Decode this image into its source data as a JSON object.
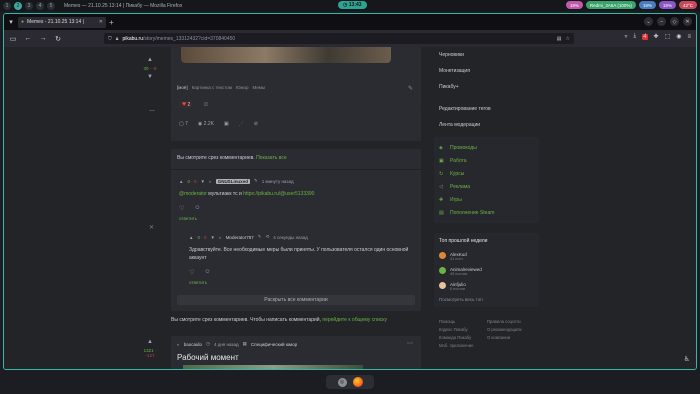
{
  "system": {
    "workspaces": [
      "1",
      "2",
      "3",
      "4",
      "5"
    ],
    "active_workspace": "2",
    "window_title": "Memes — 21.10.25 13:14 | Пикабу — Mozilla Firefox",
    "clock": "13:43",
    "indicators": [
      {
        "label": "19%",
        "color": "#c05aa8"
      },
      {
        "label": "Redmi_3A6A (100%)",
        "color": "#3aa36b"
      },
      {
        "label": "19%",
        "color": "#4a7ac0"
      },
      {
        "label": "19%",
        "color": "#8a56c8"
      },
      {
        "label": "42°C",
        "color": "#c84a5a"
      }
    ]
  },
  "browser": {
    "tab_title": "Memes - 21.10.25 13:14 |",
    "url_host": "pikabu.ru",
    "url_path": "/story/memes_13312432?cid=370840450",
    "ext_badge": "4"
  },
  "post": {
    "vote_score": "30",
    "vote_neg": "-8",
    "tags": [
      "[моё]",
      "Картинка с текстом",
      "Юмор",
      "Мемы"
    ],
    "hearts": "2",
    "comments_count": "7",
    "views": "2.2K"
  },
  "comments": {
    "slice_text": "Вы смотрите срез комментариев.",
    "show_all": "Показать все",
    "c1": {
      "rating_pos": "0",
      "rating_neg": "0",
      "user": "GNUSLinuxed",
      "time": "1 минуту назад",
      "mention": "@moderator",
      "text": " мультиакк тс и ",
      "link": "https://pikabu.ru/@user5133390",
      "reply": "ответить"
    },
    "c2": {
      "rating_pos": "0",
      "rating_neg": "0",
      "user": "Moderator787",
      "time": "4 секунды назад",
      "text": "Здравствуйте. Все необходимые меры были приняты. У пользователя остался один основной аккаунт",
      "reply": "ответить"
    },
    "expand": "Раскрыть все комментарии",
    "slice2_text": "Вы смотрите срез комментариев. Чтобы написать комментарий, ",
    "slice2_link": "перейдите к общему списку"
  },
  "post2": {
    "author": "baocaido",
    "time": "4 дня назад",
    "community": "Специфический юмор",
    "title": "Рабочий момент",
    "vote_score": "1321",
    "vote_neg": "-127"
  },
  "sidebar": {
    "menu": [
      "Черновики",
      "Монетизация",
      "Пикабу+",
      "Редактирование тегов",
      "Лента модерации"
    ],
    "green": [
      "Промокоды",
      "Работа",
      "Курсы",
      "Реклама",
      "Игры",
      "Пополнение Steam"
    ],
    "top_title": "Топ прошлой недели",
    "top": [
      {
        "name": "AlexKud",
        "sub": "41 пост",
        "color": "#e0883a"
      },
      {
        "name": "Animalreviewed",
        "sub": "45 постов",
        "color": "#6bb344"
      },
      {
        "name": "Ainfjulio",
        "sub": "8 постов",
        "color": "#e8c29a"
      }
    ],
    "top_all": "Посмотреть весь топ",
    "footer": [
      "Помощь",
      "Правила соцсети",
      "Кодекс Пикабу",
      "О рекомендациях",
      "Команда Пикабу",
      "О компании",
      "Моб. приложение",
      ""
    ]
  }
}
